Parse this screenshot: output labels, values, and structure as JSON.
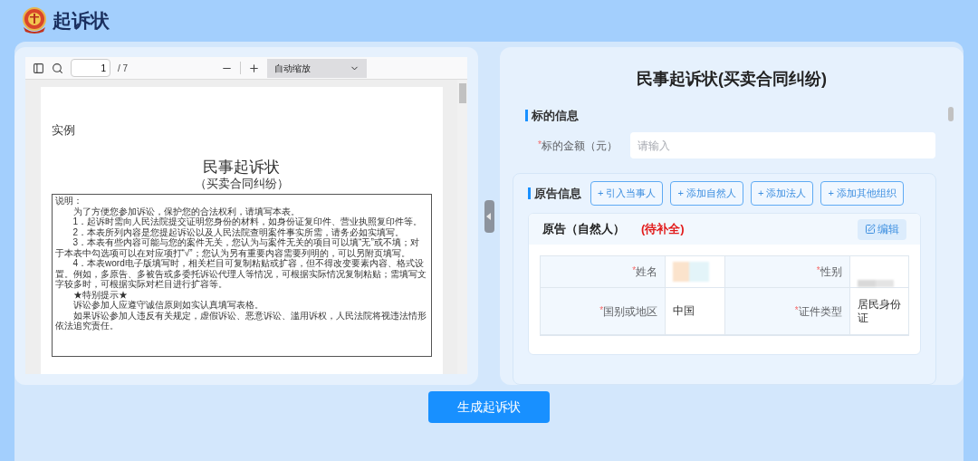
{
  "header": {
    "title": "起诉状"
  },
  "viewer": {
    "page_input": "1",
    "page_count": "/ 7",
    "zoom_select": "自动缩放",
    "document": {
      "label": "实例",
      "title": "民事起诉状",
      "subtitle": "（买卖合同纠纷）",
      "notice": [
        {
          "kind": "heading",
          "text": "说明："
        },
        {
          "kind": "para",
          "text": "为了方便您参加诉讼，保护您的合法权利，请填写本表。"
        },
        {
          "kind": "para",
          "text": "1．起诉时需向人民法院提交证明您身份的材料，如身份证复印件、营业执照复印件等。"
        },
        {
          "kind": "para",
          "text": "2．本表所列内容是您提起诉讼以及人民法院查明案件事实所需，请务必如实填写。"
        },
        {
          "kind": "para",
          "text": "3．本表有些内容可能与您的案件无关，您认为与案件无关的项目可以填“无”或不填；对于本表中勾选项可以在对应项打“√”；您认为另有重要内容需要列明的，可以另附页填写。"
        },
        {
          "kind": "para",
          "text": "4．本表word电子版填写时，相关栏目可复制粘贴或扩容，但不得改变要素内容、格式设置。例如，多原告、多被告或多委托诉讼代理人等情况，可根据实际情况复制粘贴；需填写文字较多时，可根据实际对栏目进行扩容等。"
        },
        {
          "kind": "para",
          "text": "★特别提示★"
        },
        {
          "kind": "para",
          "text": "诉讼参加人应遵守诚信原则如实认真填写表格。"
        },
        {
          "kind": "para",
          "text": "如果诉讼参加人违反有关规定，虚假诉讼、恶意诉讼、滥用诉权，人民法院将视违法情形依法追究责任。"
        }
      ]
    }
  },
  "form": {
    "title": "民事起诉状(买卖合同纠纷)",
    "subject_section": {
      "heading": "标的信息",
      "field": {
        "required_mark": "*",
        "label": "标的金额（元）",
        "placeholder": "请输入"
      }
    },
    "plaintiff_section": {
      "heading": "原告信息",
      "buttons": [
        "+ 引入当事人",
        "+ 添加自然人",
        "+ 添加法人",
        "+ 添加其他组织"
      ],
      "party_card": {
        "title": "原告（自然人）",
        "status": "(待补全)",
        "edit_button": "编辑",
        "rows": [
          [
            {
              "required_mark": "*",
              "label": "姓名",
              "redacted": true
            },
            {
              "required_mark": "*",
              "label": "性别",
              "redacted": true
            }
          ],
          [
            {
              "required_mark": "*",
              "label": "国别或地区",
              "value": "中国",
              "redacted": false
            },
            {
              "required_mark": "*",
              "label": "证件类型",
              "value": "居民身份证",
              "redacted": false
            }
          ]
        ]
      }
    }
  },
  "submit_button": "生成起诉状"
}
